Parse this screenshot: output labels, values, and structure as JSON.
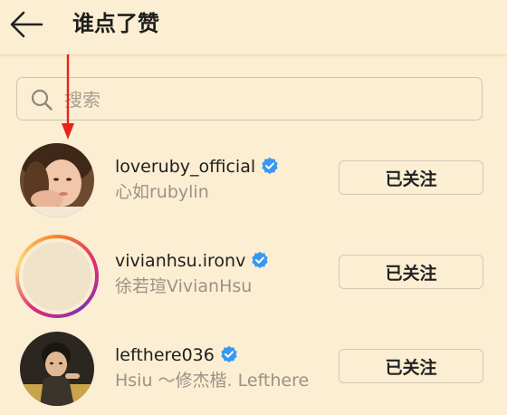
{
  "header": {
    "title": "谁点了赞",
    "back_icon": "arrow-left-icon"
  },
  "search": {
    "placeholder": "搜索",
    "value": "",
    "icon": "search-icon"
  },
  "annotation": {
    "arrow_color": "#e8231b"
  },
  "colors": {
    "background": "#fbeed2",
    "verified_badge": "#3897f0",
    "secondary_text": "#9b9287"
  },
  "users": [
    {
      "username": "loveruby_official",
      "full_name": "心如rubylin",
      "verified": true,
      "follow_label": "已关注",
      "has_story_ring": false
    },
    {
      "username": "vivianhsu.ironv",
      "full_name": "徐若瑄VivianHsu",
      "verified": true,
      "follow_label": "已关注",
      "has_story_ring": true
    },
    {
      "username": "lefthere036",
      "full_name": "Hsiu ～修杰楷.  Lefthere",
      "verified": true,
      "follow_label": "已关注",
      "has_story_ring": false
    }
  ]
}
